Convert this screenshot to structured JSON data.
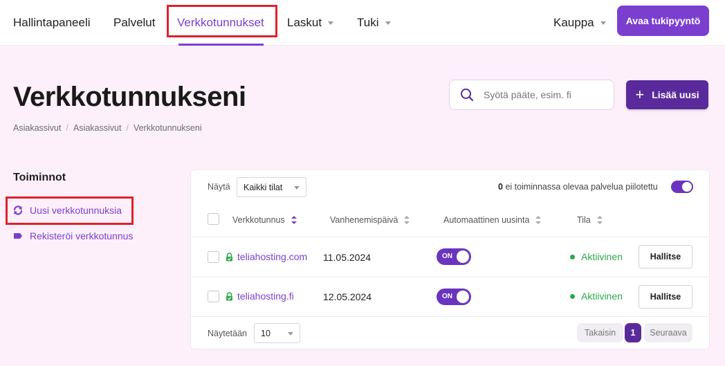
{
  "nav": {
    "items": [
      {
        "label": "Hallintapaneeli"
      },
      {
        "label": "Palvelut"
      },
      {
        "label": "Verkkotunnukset"
      },
      {
        "label": "Laskut"
      },
      {
        "label": "Tuki"
      }
    ],
    "store": "Kauppa",
    "cta": "Avaa tukipyyntö"
  },
  "header": {
    "title": "Verkkotunnukseni",
    "breadcrumb": [
      "Asiakassivut",
      "Asiakassivut",
      "Verkkotunnukseni"
    ],
    "search_placeholder": "Syötä pääte, esim. fi",
    "add_label": "Lisää uusi"
  },
  "sidebar": {
    "title": "Toiminnot",
    "items": [
      {
        "label": "Uusi verkkotunnuksia",
        "icon": "renew-icon"
      },
      {
        "label": "Rekisteröi verkkotunnus",
        "icon": "tag-icon"
      }
    ]
  },
  "table": {
    "show_label": "Näytä",
    "filter_value": "Kaikki tilat",
    "hidden_count": "0",
    "hidden_text": "ei toiminnassa olevaa palvelua piilotettu",
    "hidden_toggle_on": true,
    "columns": [
      "Verkkotunnus",
      "Vanhenemispäivä",
      "Automaattinen uusinta",
      "Tila"
    ],
    "rows": [
      {
        "domain": "teliahosting.com",
        "expiry": "11.05.2024",
        "autorenew": "ON",
        "status": "Aktiivinen",
        "action": "Hallitse"
      },
      {
        "domain": "teliahosting.fi",
        "expiry": "12.05.2024",
        "autorenew": "ON",
        "status": "Aktiivinen",
        "action": "Hallitse"
      }
    ],
    "footer": {
      "showing_label": "Näytetään",
      "page_size": "10",
      "prev": "Takaisin",
      "current_page": "1",
      "next": "Seuraava"
    }
  },
  "colors": {
    "accent": "#7b3fcf",
    "accent_dark": "#5a2a9c",
    "success": "#2ea84a",
    "highlight": "#e0202a",
    "background": "#fdf0fb"
  }
}
